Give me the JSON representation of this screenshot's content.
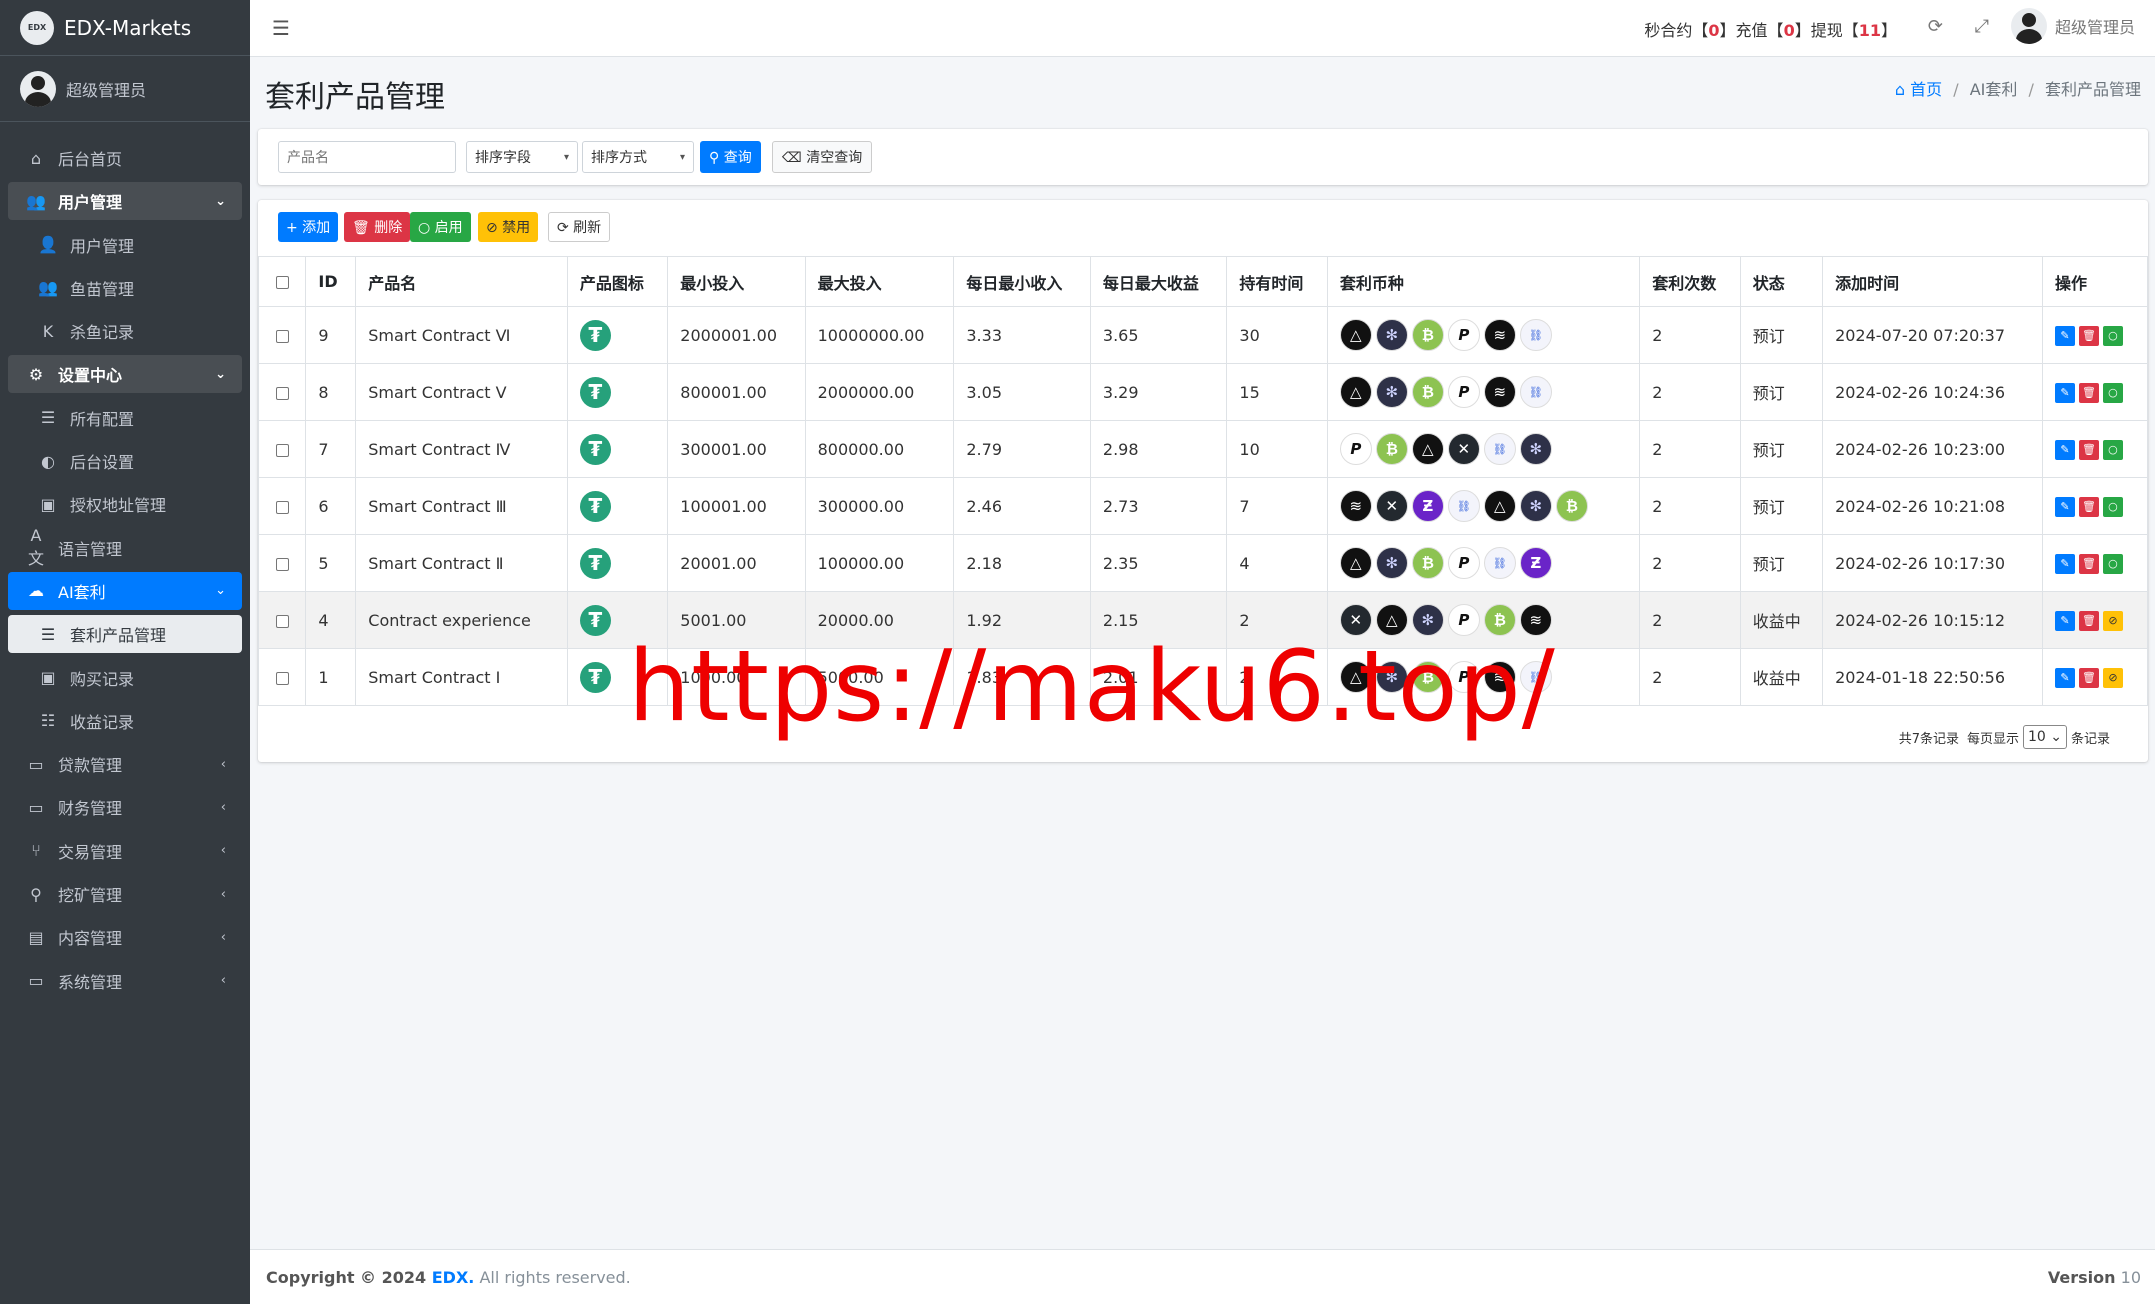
{
  "brand": {
    "logo": "EDX",
    "name": "EDX-Markets"
  },
  "sidebar_user": "超级管理员",
  "nav": [
    {
      "label": "后台首页",
      "icon": "home-icon",
      "glyph": "⌂",
      "type": "top"
    },
    {
      "label": "用户管理",
      "icon": "users-icon",
      "glyph": "👥",
      "type": "open",
      "arrow": "⌄"
    },
    {
      "label": "用户管理",
      "icon": "user-icon",
      "glyph": "👤",
      "type": "sub"
    },
    {
      "label": "鱼苗管理",
      "icon": "users-icon",
      "glyph": "👥",
      "type": "sub"
    },
    {
      "label": "杀鱼记录",
      "icon": "kill-icon",
      "glyph": "K",
      "type": "sub"
    },
    {
      "label": "设置中心",
      "icon": "gear-icon",
      "glyph": "⚙",
      "type": "open",
      "arrow": "⌄"
    },
    {
      "label": "所有配置",
      "icon": "list-icon",
      "glyph": "☰",
      "type": "sub"
    },
    {
      "label": "后台设置",
      "icon": "half-circle-icon",
      "glyph": "◐",
      "type": "sub"
    },
    {
      "label": "授权地址管理",
      "icon": "address-book-icon",
      "glyph": "▣",
      "type": "sub"
    },
    {
      "label": "语言管理",
      "icon": "language-icon",
      "glyph": "A文",
      "type": "top"
    },
    {
      "label": "AI套利",
      "icon": "robot-icon",
      "glyph": "☁",
      "type": "active",
      "arrow": "⌄"
    },
    {
      "label": "套利产品管理",
      "icon": "list-icon",
      "glyph": "☰",
      "type": "cur"
    },
    {
      "label": "购买记录",
      "icon": "receipt-icon",
      "glyph": "▣",
      "type": "sub"
    },
    {
      "label": "收益记录",
      "icon": "list-check-icon",
      "glyph": "☷",
      "type": "sub"
    },
    {
      "label": "贷款管理",
      "icon": "money-icon",
      "glyph": "▭",
      "type": "top",
      "arrow": "‹"
    },
    {
      "label": "财务管理",
      "icon": "money-icon",
      "glyph": "▭",
      "type": "top",
      "arrow": "‹"
    },
    {
      "label": "交易管理",
      "icon": "fork-icon",
      "glyph": "⑂",
      "type": "top",
      "arrow": "‹"
    },
    {
      "label": "挖矿管理",
      "icon": "search-icon",
      "glyph": "⚲",
      "type": "top",
      "arrow": "‹"
    },
    {
      "label": "内容管理",
      "icon": "newspaper-icon",
      "glyph": "▤",
      "type": "top",
      "arrow": "‹"
    },
    {
      "label": "系统管理",
      "icon": "monitor-icon",
      "glyph": "▭",
      "type": "top",
      "arrow": "‹"
    }
  ],
  "topbar": {
    "s1": "秒合约【",
    "v1": "0",
    "s2": "】充值【",
    "v2": "0",
    "s3": "】提现【",
    "v3": "11",
    "s4": "】",
    "user": "超级管理员",
    "menu_glyph": "☰",
    "refresh_glyph": "⟳",
    "expand_glyph": "⤢"
  },
  "page_title": "套利产品管理",
  "breadcrumb": {
    "home": "⌂ 首页",
    "sep": "/",
    "b2": "AI套利",
    "b3": "套利产品管理"
  },
  "filter": {
    "placeholder": "产品名",
    "sort_field": "排序字段",
    "sort_order": "排序方式",
    "search": "⚲ 查询",
    "clear": "⌫ 清空查询",
    "caret": "▾"
  },
  "toolbar": {
    "add": "+ 添加",
    "delete": "🗑 删除",
    "enable": "○ 启用",
    "disable": "⊘ 禁用",
    "refresh": "⟳ 刷新"
  },
  "table": {
    "headers": [
      "",
      "ID",
      "产品名",
      "产品图标",
      "最小投入",
      "最大投入",
      "每日最小收入",
      "每日最大收益",
      "持有时间",
      "套利币种",
      "套利次数",
      "状态",
      "添加时间",
      "操作"
    ],
    "rows": [
      {
        "id": "9",
        "name": "Smart Contract Ⅵ",
        "min": "2000001.00",
        "max": "10000000.00",
        "dmin": "3.33",
        "dmax": "3.65",
        "hold": "30",
        "coins": [
          "eos",
          "atom",
          "btc",
          "dot",
          "xlm",
          "link"
        ],
        "times": "2",
        "status": "预订",
        "time": "2024-07-20 07:20:37",
        "active": true
      },
      {
        "id": "8",
        "name": "Smart Contract Ⅴ",
        "min": "800001.00",
        "max": "2000000.00",
        "dmin": "3.05",
        "dmax": "3.29",
        "hold": "15",
        "coins": [
          "eos",
          "atom",
          "btc",
          "dot",
          "xlm",
          "link"
        ],
        "times": "2",
        "status": "预订",
        "time": "2024-02-26 10:24:36",
        "active": true
      },
      {
        "id": "7",
        "name": "Smart Contract Ⅳ",
        "min": "300001.00",
        "max": "800000.00",
        "dmin": "2.79",
        "dmax": "2.98",
        "hold": "10",
        "coins": [
          "dot",
          "btc",
          "eos",
          "xrp",
          "link",
          "atom"
        ],
        "times": "2",
        "status": "预订",
        "time": "2024-02-26 10:23:00",
        "active": true
      },
      {
        "id": "6",
        "name": "Smart Contract Ⅲ",
        "min": "100001.00",
        "max": "300000.00",
        "dmin": "2.46",
        "dmax": "2.73",
        "hold": "7",
        "coins": [
          "xlm",
          "xrp",
          "zec",
          "link",
          "eos",
          "atom",
          "btc"
        ],
        "times": "2",
        "status": "预订",
        "time": "2024-02-26 10:21:08",
        "active": true
      },
      {
        "id": "5",
        "name": "Smart Contract Ⅱ",
        "min": "20001.00",
        "max": "100000.00",
        "dmin": "2.18",
        "dmax": "2.35",
        "hold": "4",
        "coins": [
          "eos",
          "atom",
          "btc",
          "dot",
          "link",
          "zec"
        ],
        "times": "2",
        "status": "预订",
        "time": "2024-02-26 10:17:30",
        "active": true
      },
      {
        "id": "4",
        "name": "Contract experience",
        "min": "5001.00",
        "max": "20000.00",
        "dmin": "1.92",
        "dmax": "2.15",
        "hold": "2",
        "coins": [
          "xrp",
          "eos",
          "atom",
          "dot",
          "btc",
          "xlm"
        ],
        "times": "2",
        "status": "收益中",
        "time": "2024-02-26 10:15:12",
        "active": false
      },
      {
        "id": "1",
        "name": "Smart Contract Ⅰ",
        "min": "1000.00",
        "max": "5000.00",
        "dmin": "1.83",
        "dmax": "2.01",
        "hold": "2",
        "coins": [
          "eos",
          "atom",
          "btc",
          "dot",
          "xlm",
          "link"
        ],
        "times": "2",
        "status": "收益中",
        "time": "2024-01-18 22:50:56",
        "active": false
      }
    ]
  },
  "coin_glyphs": {
    "eos": "△",
    "atom": "✻",
    "btc": "₿",
    "dot": "P",
    "xlm": "≋",
    "link": "⛓",
    "xrp": "✕",
    "zec": "Ƶ"
  },
  "usdt_glyph": "₮",
  "op_glyphs": {
    "edit": "✎",
    "delete": "🗑",
    "enable": "○",
    "disable": "⊘"
  },
  "pager": {
    "total": "共7条记录",
    "per_page": "每页显示",
    "value": "10 ⌄",
    "suffix": "条记录"
  },
  "watermark": "https://maku6.top/",
  "footer": {
    "copyright": "Copyright © 2024 ",
    "edx": "EDX.",
    "rights": " All rights reserved.",
    "version_label": "Version",
    "version": " 10"
  },
  "colors": {
    "primary": "#007bff",
    "danger": "#dc3545",
    "success": "#28a745",
    "warning": "#ffc107",
    "sidebar": "#343a40",
    "usdt": "#26a17b"
  }
}
